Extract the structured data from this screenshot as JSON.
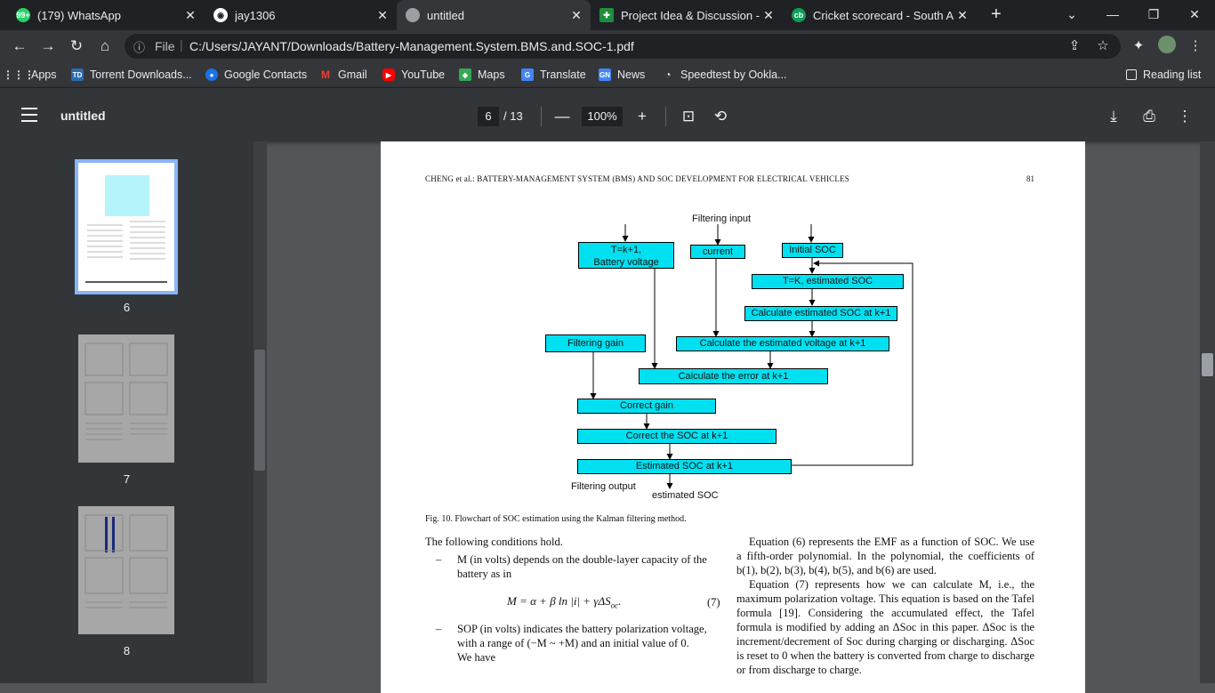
{
  "browser": {
    "tabs": [
      {
        "title": "(179) WhatsApp",
        "icon": "whatsapp-icon",
        "badge": "99+",
        "color": "#25d366"
      },
      {
        "title": "jay1306",
        "icon": "github-icon",
        "color": "#202124"
      },
      {
        "title": "untitled",
        "icon": "globe-icon",
        "color": "#5f6368"
      },
      {
        "title": "Project Idea & Discussion - G",
        "icon": "classroom-icon",
        "color": "#1e8e3e"
      },
      {
        "title": "Cricket scorecard - South Afr",
        "icon": "cricbuzz-icon",
        "badge": "cb",
        "color": "#0f9d58"
      }
    ],
    "url_scheme": "File",
    "url": "C:/Users/JAYANT/Downloads/Battery-Management.System.BMS.and.SOC-1.pdf",
    "bookmarks": [
      {
        "label": "Apps",
        "icon": "apps-grid-icon",
        "color": "#e8eaed"
      },
      {
        "label": "Torrent Downloads...",
        "icon": "torrent-icon",
        "color": "#2b6cb0"
      },
      {
        "label": "Google Contacts",
        "icon": "contacts-icon",
        "color": "#1a73e8"
      },
      {
        "label": "Gmail",
        "icon": "gmail-icon",
        "color": "#ea4335"
      },
      {
        "label": "YouTube",
        "icon": "youtube-icon",
        "color": "#ff0000"
      },
      {
        "label": "Maps",
        "icon": "maps-icon",
        "color": "#34a853"
      },
      {
        "label": "Translate",
        "icon": "translate-icon",
        "color": "#4285f4"
      },
      {
        "label": "News",
        "icon": "news-icon",
        "color": "#4285f4"
      },
      {
        "label": "Speedtest by Ookla...",
        "icon": "speedtest-icon",
        "color": "#202124"
      }
    ],
    "reading_list": "Reading list"
  },
  "pdf": {
    "title": "untitled",
    "current_page": "6",
    "total_pages": "/ 13",
    "zoom": "100%",
    "thumbnails": [
      {
        "number": "6",
        "selected": true
      },
      {
        "number": "7",
        "selected": false
      },
      {
        "number": "8",
        "selected": false
      }
    ]
  },
  "document": {
    "running_head": "CHENG et al.: BATTERY-MANAGEMENT SYSTEM (BMS) AND SOC DEVELOPMENT FOR ELECTRICAL VEHICLES",
    "page_number": "81",
    "flowchart": {
      "filtering_input": "Filtering input",
      "battery_voltage_line1": "T=k+1,",
      "battery_voltage_line2": "Battery voltage",
      "current": "current",
      "initial_soc": "Initial SOC",
      "estimated_soc_k": "T=K, estimated SOC",
      "calc_soc_k1": "Calculate estimated SOC at k+1",
      "filtering_gain": "Filtering gain",
      "calc_voltage": "Calculate the estimated voltage at k+1",
      "calc_error": "Calculate the error at k+1",
      "correct_gain": "Correct gain",
      "correct_soc": "Correct the SOC at k+1",
      "estimated_soc_k1": "Estimated SOC at k+1",
      "filtering_output": "Filtering output",
      "estimated_soc": "estimated SOC"
    },
    "caption": "Fig. 10.   Flowchart of SOC estimation using the Kalman filtering method.",
    "left_col_intro": "The following conditions hold.",
    "bullet1_line1": "M (in volts) depends on the double-layer capacity of the",
    "bullet1_line2": "battery as in",
    "equation7": "M = α + β ln |i| + γΔS",
    "equation7_sub": "oc",
    "equation7_num": "(7)",
    "bullet2_line1": "SOP (in volts) indicates the battery polarization voltage,",
    "bullet2_line2": "with a range of (−M ~ +M) and an initial value of 0.",
    "bullet2_line3": "We have",
    "right_col_p1": "Equation (6) represents the EMF as a function of SOC. We use a fifth-order polynomial. In the polynomial, the coefficients of b(1), b(2), b(3), b(4), b(5), and b(6) are used.",
    "right_col_p2": "Equation (7) represents how we can calculate M, i.e., the maximum polarization voltage. This equation is based on the Tafel formula [19]. Considering the accumulated effect, the Tafel formula is modified by adding an ΔSoc in this paper. ΔSoc is the increment/decrement of Soc during charging or discharging. ΔSoc is reset to 0 when the battery is converted from charge to discharge or from discharge to charge."
  }
}
